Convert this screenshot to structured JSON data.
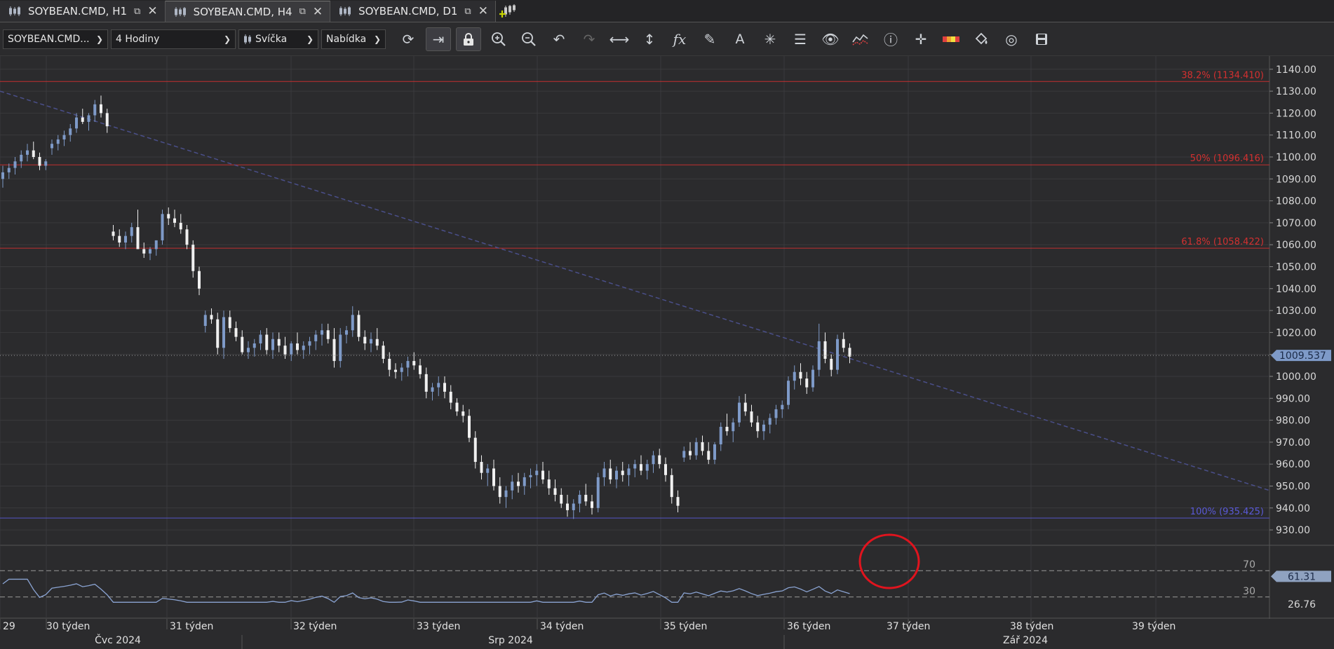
{
  "tabs": [
    {
      "label": "SOYBEAN.CMD, H1",
      "active": false
    },
    {
      "label": "SOYBEAN.CMD, H4",
      "active": true
    },
    {
      "label": "SOYBEAN.CMD, D1",
      "active": false
    }
  ],
  "toolbar": {
    "instrument": "SOYBEAN.CMD...",
    "timeframe": "4 Hodiny",
    "chart_type": "Svíčka",
    "price_side": "Nabídka",
    "icons": [
      "refresh-icon",
      "autoscroll-icon",
      "lock-icon",
      "zoom-in-icon",
      "zoom-out-icon",
      "undo-icon",
      "redo-icon",
      "horizontal-stretch-icon",
      "vertical-stretch-icon",
      "indicator-fx-icon",
      "pencil-icon",
      "text-icon",
      "pattern-icon",
      "layers-icon",
      "eye-icon",
      "compare-icon",
      "info-icon",
      "crosshair-icon",
      "color-bar-icon",
      "paint-bucket-icon",
      "snapshot-icon",
      "save-icon"
    ]
  },
  "colors": {
    "bg": "#2b2b2d",
    "grid": "#3a3a3d",
    "bull": "#7e9ac8",
    "bear": "#f0f0f0",
    "fib": "#d43030",
    "fib100": "#5a5ad8",
    "trend": "#4a4f8a",
    "price_tag": "#7e9ac8",
    "rsi": "#8aa3d2",
    "annotation": "#e0141e"
  },
  "price_axis": {
    "ticks": [
      "1140.00",
      "1130.00",
      "1120.00",
      "1110.00",
      "1100.00",
      "1090.00",
      "1080.00",
      "1070.00",
      "1060.00",
      "1050.00",
      "1040.00",
      "1030.00",
      "1020.00",
      "1010.00",
      "1000.00",
      "990.00",
      "980.00",
      "970.00",
      "960.00",
      "950.00",
      "940.00",
      "930.00"
    ],
    "current_price": "1009.537"
  },
  "fib_levels": [
    {
      "label": "38.2% (1134.410)",
      "price": 1134.41
    },
    {
      "label": "50% (1096.416)",
      "price": 1096.416
    },
    {
      "label": "61.8% (1058.422)",
      "price": 1058.422
    },
    {
      "label": "100% (935.425)",
      "price": 935.425
    }
  ],
  "rsi": {
    "level_high": "70",
    "level_low": "30",
    "current": "61.31",
    "lower_value": "26.76"
  },
  "time_axis": {
    "weeks": [
      "29",
      "30 týden",
      "31 týden",
      "32 týden",
      "33 týden",
      "34 týden",
      "35 týden",
      "36 týden",
      "37 týden",
      "38 týden",
      "39 týden"
    ],
    "months": [
      "Čvc 2024",
      "Srp 2024",
      "Zář 2024"
    ]
  },
  "chart_data": {
    "type": "candlestick",
    "symbol": "SOYBEAN.CMD",
    "timeframe": "H4",
    "ylim": [
      923,
      1146
    ],
    "candles": [
      [
        1090,
        1096,
        1086,
        1093
      ],
      [
        1093,
        1097,
        1090,
        1095
      ],
      [
        1095,
        1100,
        1092,
        1098
      ],
      [
        1098,
        1103,
        1095,
        1101
      ],
      [
        1101,
        1106,
        1098,
        1103
      ],
      [
        1103,
        1107,
        1099,
        1100
      ],
      [
        1100,
        1102,
        1094,
        1096
      ],
      [
        1096,
        1099,
        1094,
        1098
      ],
      [
        1104,
        1108,
        1101,
        1106
      ],
      [
        1106,
        1110,
        1103,
        1108
      ],
      [
        1108,
        1112,
        1105,
        1110
      ],
      [
        1110,
        1115,
        1107,
        1113
      ],
      [
        1113,
        1120,
        1111,
        1118
      ],
      [
        1118,
        1122,
        1115,
        1116
      ],
      [
        1116,
        1120,
        1112,
        1119
      ],
      [
        1119,
        1126,
        1116,
        1124
      ],
      [
        1124,
        1128,
        1118,
        1120
      ],
      [
        1120,
        1122,
        1111,
        1114
      ],
      [
        1066,
        1069,
        1062,
        1064
      ],
      [
        1064,
        1067,
        1059,
        1061
      ],
      [
        1061,
        1066,
        1058,
        1064
      ],
      [
        1064,
        1070,
        1061,
        1068
      ],
      [
        1068,
        1076,
        1065,
        1058
      ],
      [
        1058,
        1061,
        1054,
        1056
      ],
      [
        1056,
        1059,
        1053,
        1058
      ],
      [
        1058,
        1062,
        1055,
        1062
      ],
      [
        1062,
        1076,
        1060,
        1074
      ],
      [
        1074,
        1077,
        1069,
        1072
      ],
      [
        1072,
        1076,
        1068,
        1070
      ],
      [
        1070,
        1074,
        1065,
        1067
      ],
      [
        1067,
        1069,
        1058,
        1060
      ],
      [
        1060,
        1062,
        1045,
        1048
      ],
      [
        1048,
        1050,
        1037,
        1040
      ],
      [
        1023,
        1030,
        1020,
        1028
      ],
      [
        1028,
        1031,
        1024,
        1026
      ],
      [
        1026,
        1029,
        1010,
        1013
      ],
      [
        1013,
        1030,
        1008,
        1027
      ],
      [
        1027,
        1030,
        1020,
        1022
      ],
      [
        1022,
        1025,
        1016,
        1018
      ],
      [
        1018,
        1021,
        1010,
        1011
      ],
      [
        1011,
        1016,
        1008,
        1013
      ],
      [
        1013,
        1017,
        1009,
        1015
      ],
      [
        1015,
        1021,
        1012,
        1019
      ],
      [
        1019,
        1022,
        1010,
        1012
      ],
      [
        1012,
        1020,
        1008,
        1017
      ],
      [
        1017,
        1020,
        1011,
        1014
      ],
      [
        1014,
        1018,
        1008,
        1010
      ],
      [
        1010,
        1016,
        1007,
        1015
      ],
      [
        1015,
        1020,
        1010,
        1012
      ],
      [
        1012,
        1016,
        1008,
        1014
      ],
      [
        1014,
        1018,
        1010,
        1016
      ],
      [
        1016,
        1021,
        1012,
        1019
      ],
      [
        1019,
        1024,
        1014,
        1021
      ],
      [
        1021,
        1024,
        1015,
        1017
      ],
      [
        1017,
        1022,
        1004,
        1007
      ],
      [
        1007,
        1022,
        1004,
        1019
      ],
      [
        1019,
        1023,
        1015,
        1021
      ],
      [
        1021,
        1032,
        1018,
        1028
      ],
      [
        1028,
        1030,
        1016,
        1018
      ],
      [
        1018,
        1021,
        1012,
        1015
      ],
      [
        1015,
        1020,
        1011,
        1017
      ],
      [
        1017,
        1022,
        1012,
        1014
      ],
      [
        1014,
        1016,
        1006,
        1008
      ],
      [
        1008,
        1011,
        1000,
        1003
      ],
      [
        1003,
        1006,
        999,
        1002
      ],
      [
        1002,
        1006,
        998,
        1004
      ],
      [
        1004,
        1009,
        1000,
        1007
      ],
      [
        1007,
        1011,
        1003,
        1005
      ],
      [
        1005,
        1008,
        999,
        1001
      ],
      [
        1001,
        1004,
        990,
        993
      ],
      [
        993,
        997,
        989,
        995
      ],
      [
        995,
        1000,
        991,
        997
      ],
      [
        997,
        1000,
        990,
        993
      ],
      [
        993,
        996,
        985,
        988
      ],
      [
        988,
        990,
        982,
        984
      ],
      [
        984,
        987,
        979,
        982
      ],
      [
        982,
        985,
        970,
        972
      ],
      [
        972,
        975,
        958,
        961
      ],
      [
        961,
        964,
        953,
        956
      ],
      [
        956,
        960,
        950,
        958
      ],
      [
        958,
        962,
        948,
        950
      ],
      [
        950,
        954,
        942,
        945
      ],
      [
        945,
        950,
        940,
        948
      ],
      [
        948,
        955,
        944,
        952
      ],
      [
        952,
        956,
        947,
        950
      ],
      [
        950,
        956,
        946,
        954
      ],
      [
        954,
        958,
        949,
        955
      ],
      [
        955,
        960,
        950,
        957
      ],
      [
        957,
        961,
        951,
        953
      ],
      [
        953,
        957,
        946,
        949
      ],
      [
        949,
        953,
        943,
        946
      ],
      [
        946,
        949,
        940,
        942
      ],
      [
        942,
        946,
        936,
        939
      ],
      [
        939,
        944,
        935,
        942
      ],
      [
        942,
        948,
        938,
        946
      ],
      [
        946,
        951,
        941,
        943
      ],
      [
        943,
        946,
        937,
        940
      ],
      [
        940,
        956,
        938,
        954
      ],
      [
        954,
        961,
        950,
        958
      ],
      [
        958,
        962,
        951,
        953
      ],
      [
        953,
        959,
        949,
        957
      ],
      [
        957,
        961,
        952,
        955
      ],
      [
        955,
        960,
        950,
        958
      ],
      [
        958,
        962,
        954,
        960
      ],
      [
        960,
        964,
        955,
        957
      ],
      [
        957,
        962,
        953,
        960
      ],
      [
        960,
        966,
        956,
        964
      ],
      [
        964,
        967,
        958,
        960
      ],
      [
        960,
        963,
        952,
        955
      ],
      [
        955,
        958,
        942,
        945
      ],
      [
        945,
        948,
        938,
        941
      ],
      [
        963,
        968,
        961,
        966
      ],
      [
        966,
        970,
        962,
        964
      ],
      [
        964,
        972,
        962,
        970
      ],
      [
        970,
        973,
        964,
        966
      ],
      [
        966,
        970,
        960,
        962
      ],
      [
        962,
        970,
        960,
        969
      ],
      [
        969,
        979,
        966,
        977
      ],
      [
        977,
        983,
        973,
        975
      ],
      [
        975,
        981,
        970,
        979
      ],
      [
        979,
        991,
        977,
        988
      ],
      [
        988,
        992,
        982,
        984
      ],
      [
        984,
        987,
        977,
        979
      ],
      [
        979,
        982,
        972,
        975
      ],
      [
        975,
        980,
        971,
        978
      ],
      [
        978,
        983,
        974,
        981
      ],
      [
        981,
        987,
        978,
        985
      ],
      [
        985,
        989,
        981,
        987
      ],
      [
        987,
        1000,
        985,
        998
      ],
      [
        998,
        1005,
        994,
        1002
      ],
      [
        1002,
        1006,
        996,
        999
      ],
      [
        999,
        1002,
        992,
        995
      ],
      [
        995,
        1005,
        993,
        1003
      ],
      [
        1003,
        1024,
        1000,
        1016
      ],
      [
        1016,
        1020,
        1006,
        1008
      ],
      [
        1008,
        1010,
        1000,
        1003
      ],
      [
        1003,
        1019,
        1001,
        1017
      ],
      [
        1017,
        1020,
        1011,
        1013
      ],
      [
        1013,
        1015,
        1006,
        1009
      ]
    ]
  }
}
